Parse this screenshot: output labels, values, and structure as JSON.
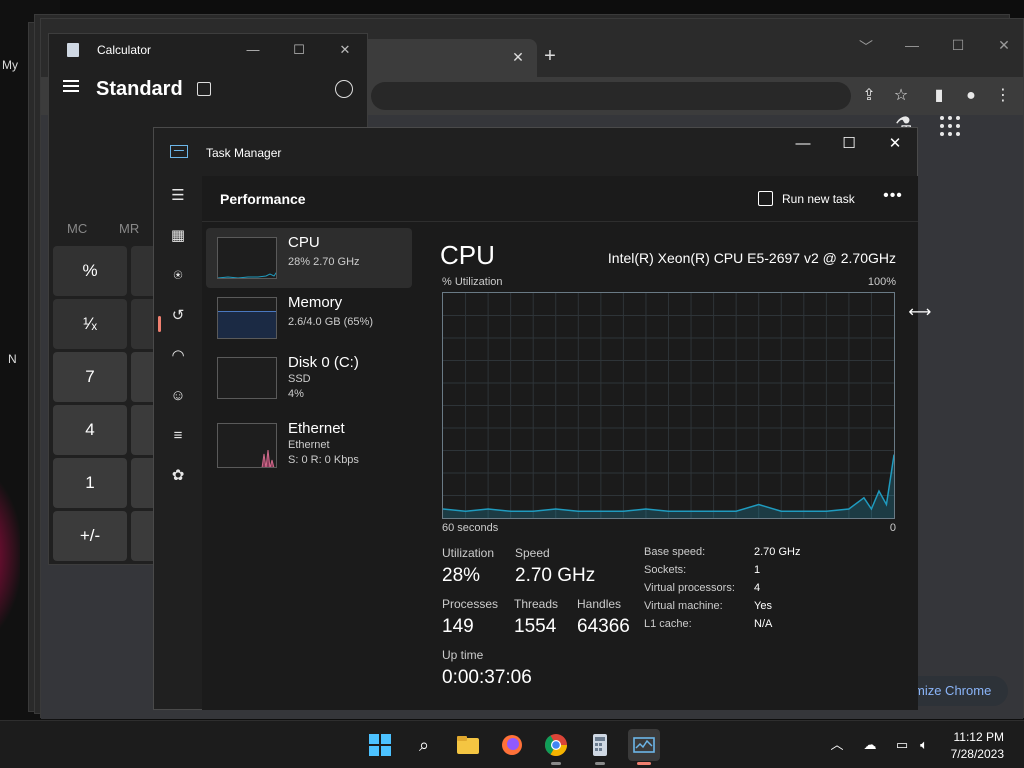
{
  "desktop": {
    "label_my": "My",
    "label_n": "N",
    "glow_color": "#c0204a"
  },
  "chrome": {
    "tab_close": "✕",
    "new_tab": "+",
    "window_controls": [
      "﹀",
      "—",
      "☐",
      "✕"
    ],
    "customize_label": "Customize Chrome",
    "customize_visible": "mize Chrome",
    "accent": "#8ab4f8"
  },
  "calculator": {
    "title": "Calculator",
    "mode": "Standard",
    "memory": [
      "MC",
      "MR"
    ],
    "keys": [
      "%",
      "¹⁄ₓ",
      "7",
      "4",
      "1",
      "+/-"
    ],
    "window_controls": [
      "—",
      "☐",
      "✕"
    ]
  },
  "task_manager": {
    "title": "Task Manager",
    "window_controls": [
      "—",
      "☐",
      "✕"
    ],
    "page_title": "Performance",
    "run_new_task": "Run new task",
    "more": "•••",
    "accent": "#f08070",
    "resources": [
      {
        "name": "CPU",
        "sub1": "28%  2.70 GHz",
        "sub2": ""
      },
      {
        "name": "Memory",
        "sub1": "2.6/4.0 GB (65%)",
        "sub2": ""
      },
      {
        "name": "Disk 0 (C:)",
        "sub1": "SSD",
        "sub2": "4%"
      },
      {
        "name": "Ethernet",
        "sub1": "Ethernet",
        "sub2": "S: 0 R: 0 Kbps"
      }
    ],
    "cpu": {
      "title": "CPU",
      "model": "Intel(R) Xeon(R) CPU E5-2697 v2 @ 2.70GHz",
      "graph_label": "% Utilization",
      "graph_max": "100%",
      "graph_span": "60 seconds",
      "graph_min": "0",
      "stats": {
        "utilization_label": "Utilization",
        "utilization": "28%",
        "speed_label": "Speed",
        "speed": "2.70 GHz",
        "processes_label": "Processes",
        "processes": "149",
        "threads_label": "Threads",
        "threads": "1554",
        "handles_label": "Handles",
        "handles": "64366",
        "uptime_label": "Up time",
        "uptime": "0:00:37:06"
      },
      "specs": [
        {
          "label": "Base speed:",
          "value": "2.70 GHz"
        },
        {
          "label": "Sockets:",
          "value": "1"
        },
        {
          "label": "Virtual processors:",
          "value": "4"
        },
        {
          "label": "Virtual machine:",
          "value": "Yes"
        },
        {
          "label": "L1 cache:",
          "value": "N/A"
        }
      ],
      "line_color": "#1f9bbf"
    }
  },
  "chart_data": {
    "type": "area",
    "title": "",
    "xlabel": "60 seconds",
    "ylabel": "% Utilization",
    "x": [
      60,
      57,
      54,
      51,
      48,
      45,
      42,
      39,
      36,
      33,
      30,
      27,
      24,
      21,
      18,
      15,
      12,
      9,
      6,
      4,
      3,
      2,
      1,
      0
    ],
    "ylim": [
      0,
      100
    ],
    "series": [
      {
        "values": [
          4,
          3,
          4,
          3,
          3,
          4,
          3,
          3,
          3,
          4,
          3,
          3,
          3,
          3,
          6,
          3,
          3,
          3,
          4,
          9,
          4,
          12,
          6,
          28
        ]
      }
    ]
  },
  "taskbar": {
    "apps": [
      "start",
      "search",
      "file-explorer",
      "firefox",
      "chrome",
      "calculator",
      "task-manager"
    ],
    "tray_chevron": "︿",
    "time": "11:12 PM",
    "date": "7/28/2023"
  }
}
